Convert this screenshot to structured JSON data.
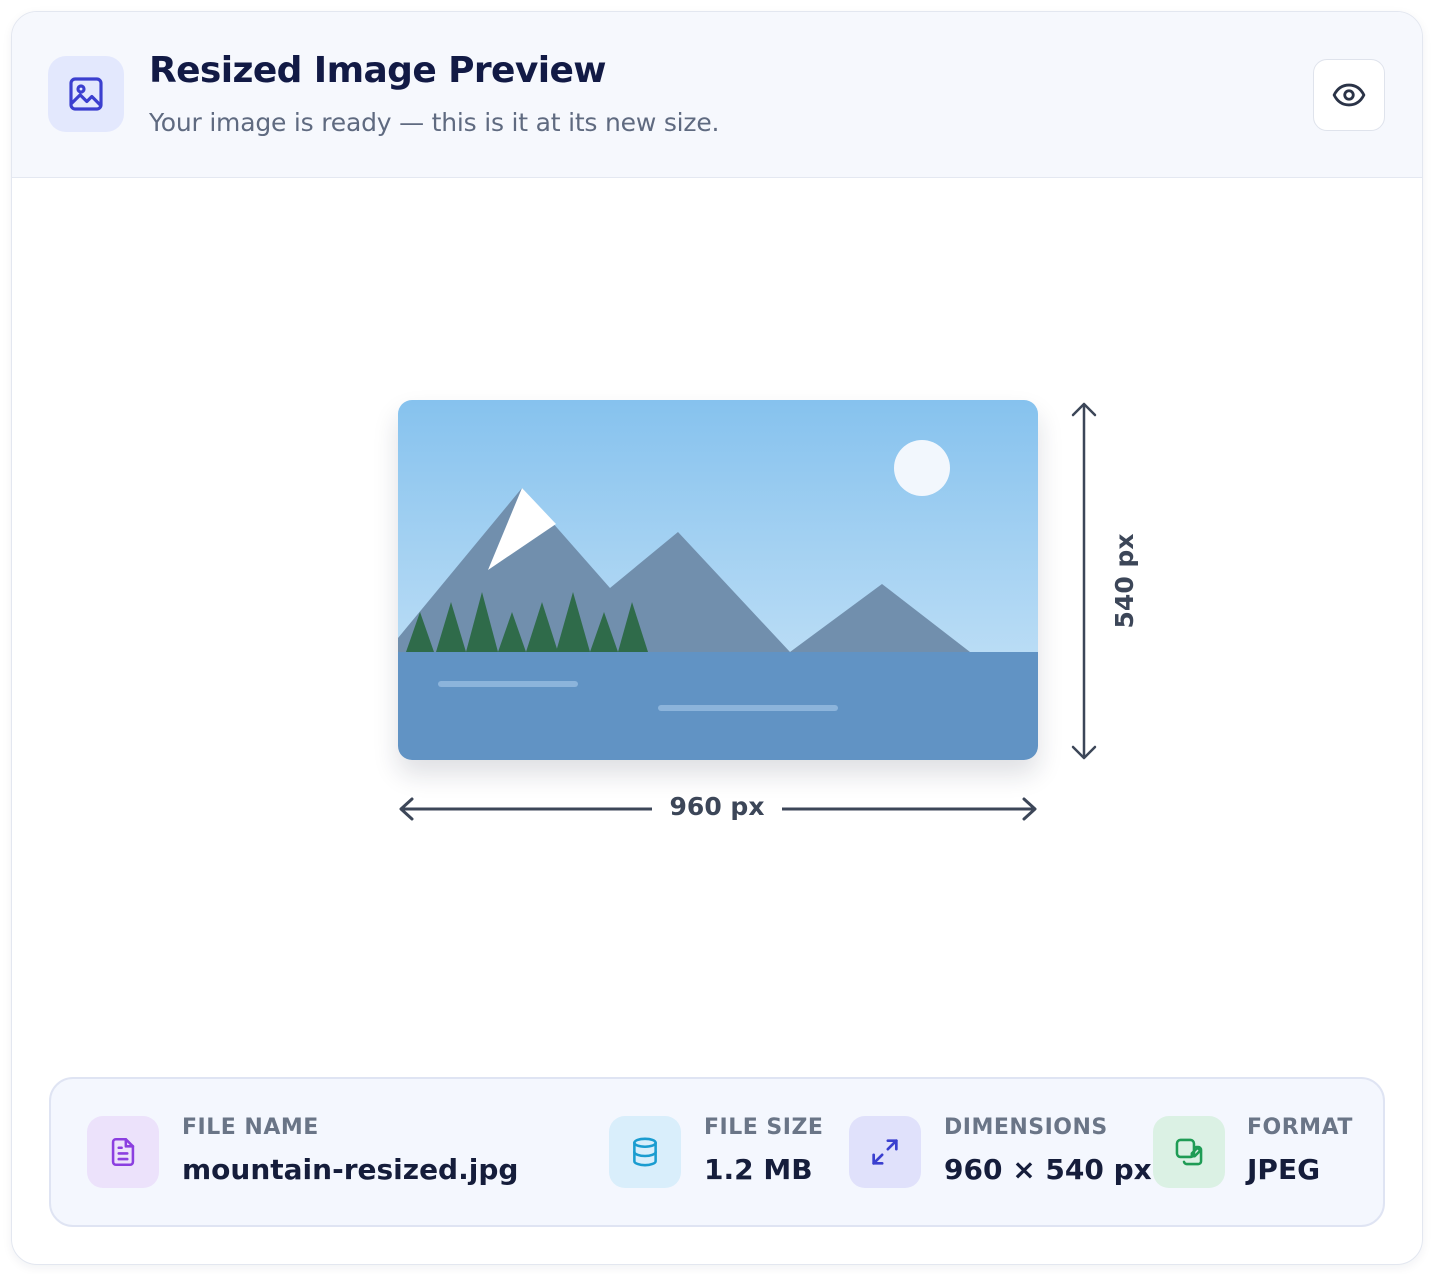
{
  "header": {
    "title": "Resized Image Preview",
    "subtitle": "Your image is ready — this is it at its new size.",
    "icon": "image-icon",
    "action_icon": "eye-icon"
  },
  "preview": {
    "width_label": "960 px",
    "height_label": "540 px"
  },
  "info": [
    {
      "label": "FILE NAME",
      "value": "mountain-resized.jpg",
      "icon": "file-text-icon",
      "color": "#8b3fe0",
      "bg": "#ece2fb"
    },
    {
      "label": "FILE SIZE",
      "value": "1.2 MB",
      "icon": "database-icon",
      "color": "#1a9cd0",
      "bg": "#d9eefb"
    },
    {
      "label": "DIMENSIONS",
      "value": "960 × 540 px",
      "icon": "expand-arrows-icon",
      "color": "#3a3fcf",
      "bg": "#e0e1fb"
    },
    {
      "label": "FORMAT",
      "value": "JPEG",
      "icon": "copy-edit-icon",
      "color": "#1f9c55",
      "bg": "#dbf1e4"
    }
  ],
  "colors": {
    "accent": "#3b3fcf",
    "title": "#121a45",
    "sky_top": "#86c2ee",
    "sky_bottom": "#b9dcf5",
    "mountain": "#718fad",
    "trees": "#2f6b4a",
    "water": "#6193c4"
  }
}
